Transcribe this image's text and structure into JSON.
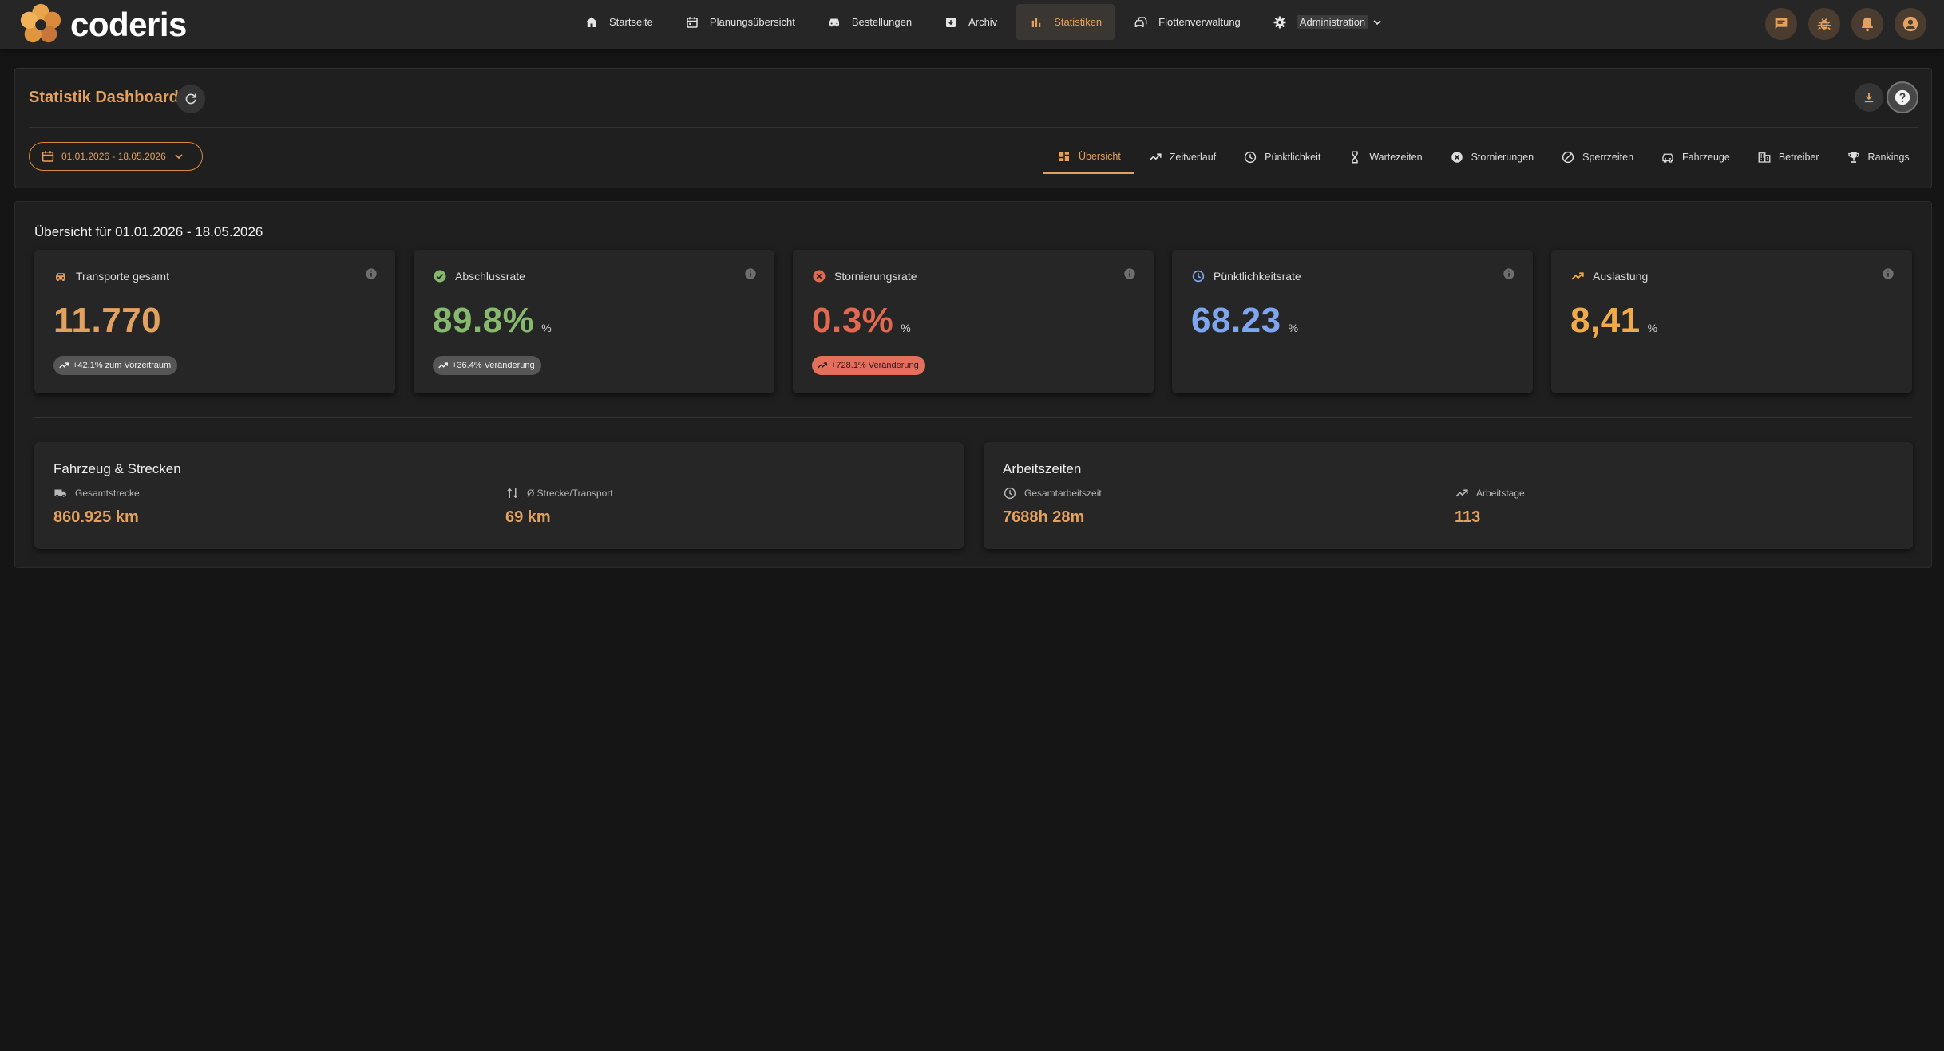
{
  "app": {
    "name": "coderis"
  },
  "nav": {
    "items": [
      {
        "label": "Startseite",
        "icon": "home-icon"
      },
      {
        "label": "Planungsübersicht",
        "icon": "calendar-icon"
      },
      {
        "label": "Bestellungen",
        "icon": "car-icon"
      },
      {
        "label": "Archiv",
        "icon": "archive-icon"
      },
      {
        "label": "Statistiken",
        "icon": "bar-chart-icon",
        "active": true
      },
      {
        "label": "Flottenverwaltung",
        "icon": "fleet-icon"
      },
      {
        "label": "Administration",
        "icon": "gear-icon",
        "has_dropdown": true
      }
    ],
    "actions": [
      "chat-icon",
      "bug-icon",
      "bell-icon",
      "account-icon"
    ]
  },
  "header": {
    "title": "Statistik Dashboard",
    "date_range": "01.01.2026 - 18.05.2026",
    "tabs": [
      {
        "label": "Übersicht",
        "icon": "dashboard-icon",
        "active": true
      },
      {
        "label": "Zeitverlauf",
        "icon": "trend-icon"
      },
      {
        "label": "Pünktlichkeit",
        "icon": "clock-icon"
      },
      {
        "label": "Wartezeiten",
        "icon": "hourglass-icon"
      },
      {
        "label": "Stornierungen",
        "icon": "cancel-icon"
      },
      {
        "label": "Sperrzeiten",
        "icon": "block-icon"
      },
      {
        "label": "Fahrzeuge",
        "icon": "car-icon"
      },
      {
        "label": "Betreiber",
        "icon": "building-icon"
      },
      {
        "label": "Rankings",
        "icon": "trophy-icon"
      }
    ]
  },
  "overview": {
    "title": "Übersicht für 01.01.2026 - 18.05.2026",
    "kpis": [
      {
        "label": "Transporte gesamt",
        "icon": "car-icon",
        "value": "11.770",
        "unit": "",
        "color": "#e3a160",
        "badge": "+42.1% zum Vorzeitraum",
        "badge_style": "neutral"
      },
      {
        "label": "Abschlussrate",
        "icon": "check-circle-icon",
        "value": "89.8%",
        "unit": "%",
        "color": "#86b86e",
        "badge": "+36.4% Veränderung",
        "badge_style": "neutral"
      },
      {
        "label": "Stornierungsrate",
        "icon": "cancel-icon",
        "value": "0.3%",
        "unit": "%",
        "color": "#e2694f",
        "badge": "+728.1% Veränderung",
        "badge_style": "red"
      },
      {
        "label": "Pünktlichkeitsrate",
        "icon": "clock-icon",
        "value": "68.23",
        "unit": "%",
        "color": "#7ea6ee",
        "badge": "",
        "badge_style": "none"
      },
      {
        "label": "Auslastung",
        "icon": "trend-icon",
        "value": "8,41",
        "unit": "%",
        "color": "#f0aa4a",
        "badge": "",
        "badge_style": "none"
      }
    ],
    "cards": [
      {
        "title": "Fahrzeug & Strecken",
        "metrics": [
          {
            "label": "Gesamtstrecke",
            "icon": "truck-icon",
            "value": "860.925 km"
          },
          {
            "label": "Ø Strecke/Transport",
            "icon": "route-icon",
            "value": "69 km"
          }
        ]
      },
      {
        "title": "Arbeitszeiten",
        "metrics": [
          {
            "label": "Gesamtarbeitszeit",
            "icon": "clock-icon",
            "value": "7688h 28m"
          },
          {
            "label": "Arbeitstage",
            "icon": "trend-icon",
            "value": "113"
          }
        ]
      }
    ]
  },
  "colors": {
    "accent": "#e3a160",
    "background": "#151515",
    "panel": "#1f1f1f",
    "card": "#262626"
  }
}
